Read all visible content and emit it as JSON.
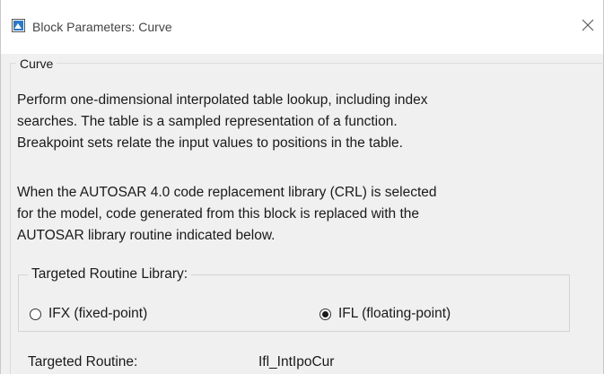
{
  "window": {
    "title": "Block Parameters: Curve"
  },
  "group": {
    "legend": "Curve",
    "description_lines": [
      "Perform one-dimensional interpolated table lookup, including index",
      "searches. The table is a sampled representation of a function.",
      "Breakpoint sets relate the input values to positions in the table."
    ],
    "autosar_lines": [
      "When the AUTOSAR 4.0 code replacement library (CRL) is selected",
      "for the model, code generated from this block is replaced with the",
      "AUTOSAR library routine indicated below."
    ]
  },
  "routine_library": {
    "legend": "Targeted Routine Library:",
    "options": [
      {
        "label": "IFX (fixed-point)",
        "selected": false
      },
      {
        "label": "IFL (floating-point)",
        "selected": true
      }
    ]
  },
  "targeted_routine": {
    "label": "Targeted Routine:",
    "value": "Ifl_IntIpoCur"
  },
  "icons": {
    "app": "simulink-block-icon",
    "close": "close-icon"
  },
  "colors": {
    "window_bg": "#f0f0f0",
    "titlebar_bg": "#ffffff",
    "icon_blue": "#2b78c8"
  }
}
